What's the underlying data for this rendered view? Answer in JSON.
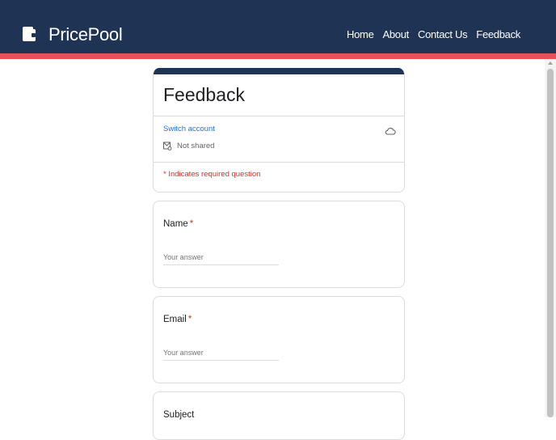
{
  "brand": {
    "name": "PricePool",
    "icon": "wallet-icon"
  },
  "nav": {
    "items": [
      "Home",
      "About",
      "Contact Us",
      "Feedback"
    ]
  },
  "colors": {
    "header": "#1f3354",
    "accent": "#e8505b",
    "link": "#1a73e8",
    "required": "#d93025"
  },
  "form": {
    "title": "Feedback",
    "switch_account": "Switch account",
    "not_shared": "Not shared",
    "required_note": "* Indicates required question",
    "questions": [
      {
        "label": "Name",
        "required_mark": "*",
        "placeholder": "Your answer"
      },
      {
        "label": "Email",
        "required_mark": "*",
        "placeholder": "Your answer"
      },
      {
        "label": "Subject",
        "required_mark": ""
      }
    ]
  }
}
